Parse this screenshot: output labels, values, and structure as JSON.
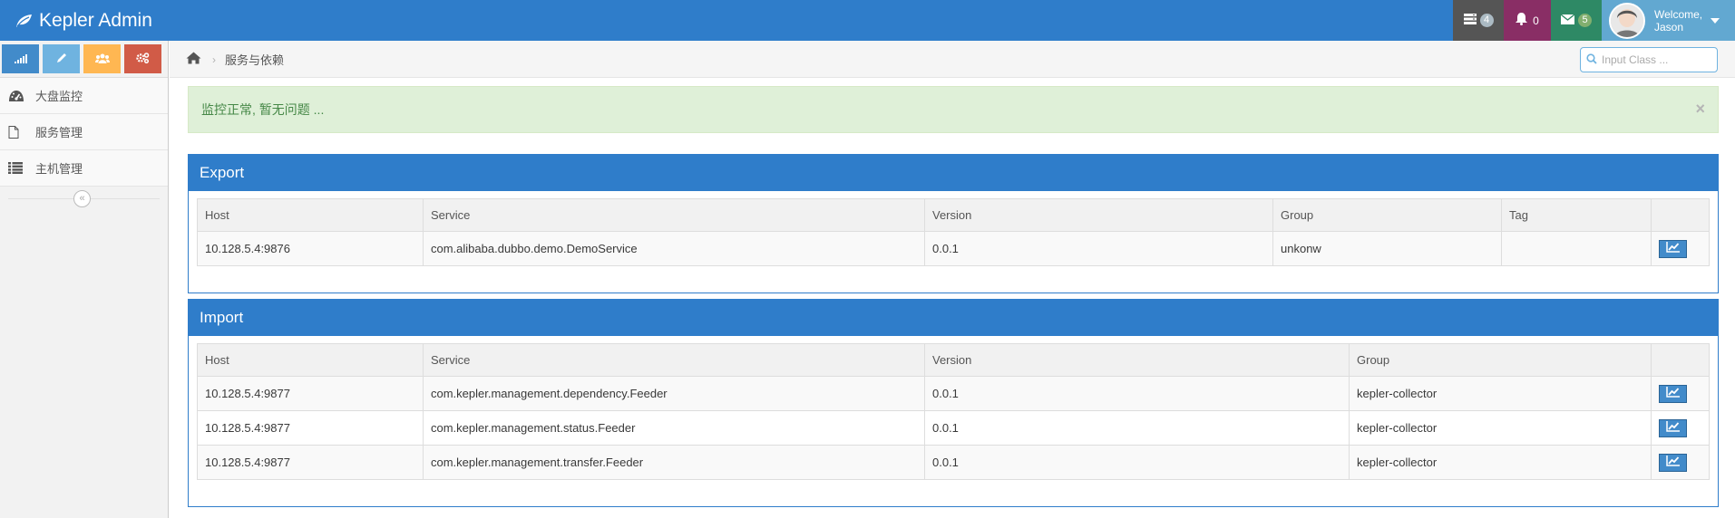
{
  "navbar": {
    "brand": "Kepler Admin",
    "tasks_count": "4",
    "notifications_count": "0",
    "messages_count": "5",
    "welcome": "Welcome,",
    "user_name": "Jason"
  },
  "sidebar": {
    "items": [
      {
        "label": "大盘监控",
        "icon": "dashboard-icon"
      },
      {
        "label": "服务管理",
        "icon": "file-icon"
      },
      {
        "label": "主机管理",
        "icon": "list-icon"
      }
    ],
    "collapse_glyph": "«"
  },
  "breadcrumb": {
    "current": "服务与依赖",
    "separator": "›"
  },
  "search": {
    "placeholder": "Input Class ..."
  },
  "alert": {
    "message": "监控正常, 暂无问题 ...",
    "close": "×"
  },
  "export": {
    "title": "Export",
    "columns": [
      "Host",
      "Service",
      "Version",
      "Group",
      "Tag",
      ""
    ],
    "rows": [
      {
        "host": "10.128.5.4:9876",
        "service": "com.alibaba.dubbo.demo.DemoService",
        "version": "0.0.1",
        "group": "unkonw",
        "tag": ""
      }
    ]
  },
  "import": {
    "title": "Import",
    "columns": [
      "Host",
      "Service",
      "Version",
      "Group",
      ""
    ],
    "rows": [
      {
        "host": "10.128.5.4:9877",
        "service": "com.kepler.management.dependency.Feeder",
        "version": "0.0.1",
        "group": "kepler-collector"
      },
      {
        "host": "10.128.5.4:9877",
        "service": "com.kepler.management.status.Feeder",
        "version": "0.0.1",
        "group": "kepler-collector"
      },
      {
        "host": "10.128.5.4:9877",
        "service": "com.kepler.management.transfer.Feeder",
        "version": "0.0.1",
        "group": "kepler-collector"
      }
    ]
  }
}
